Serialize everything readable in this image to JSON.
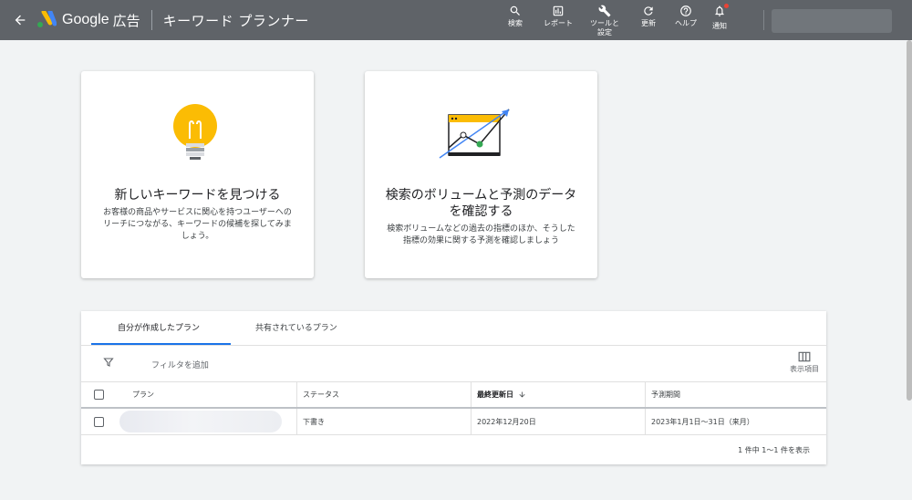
{
  "header": {
    "logo_text": "Google",
    "logo_sub": "広告",
    "page_title": "キーワード プランナー",
    "actions": [
      {
        "icon": "search-icon",
        "label": "検索"
      },
      {
        "icon": "report-icon",
        "label": "レポート"
      },
      {
        "icon": "wrench-icon",
        "label": "ツールと\n設定"
      },
      {
        "icon": "refresh-icon",
        "label": "更新"
      },
      {
        "icon": "help-icon",
        "label": "ヘルプ"
      },
      {
        "icon": "bell-icon",
        "label": "通知"
      }
    ]
  },
  "cards": {
    "discover": {
      "title": "新しいキーワードを見つける",
      "description": "お客様の商品やサービスに関心を持つユーザーへのリーチにつながる、キーワードの候補を探してみましょう。"
    },
    "forecast": {
      "title": "検索のボリュームと予測のデータを確認する",
      "description": "検索ボリュームなどの過去の指標のほか、そうした指標の効果に関する予測を確認しましょう"
    }
  },
  "plans": {
    "tabs": [
      "自分が作成したプラン",
      "共有されているプラン"
    ],
    "filter_placeholder": "フィルタを追加",
    "columns_label": "表示項目",
    "columns": [
      "プラン",
      "ステータス",
      "最終更新日",
      "予測期間"
    ],
    "rows": [
      {
        "name": "",
        "status": "下書き",
        "updated": "2022年12月20日",
        "period": "2023年1月1日〜31日（来月）"
      }
    ],
    "pagination": "1 件中 1〜1 件を表示"
  },
  "colors": {
    "topbar": "#5f6368",
    "accent": "#1a73e8",
    "bulb": "#fbbc04",
    "chart_line": "#4285f4",
    "chart_point": "#34a853"
  }
}
